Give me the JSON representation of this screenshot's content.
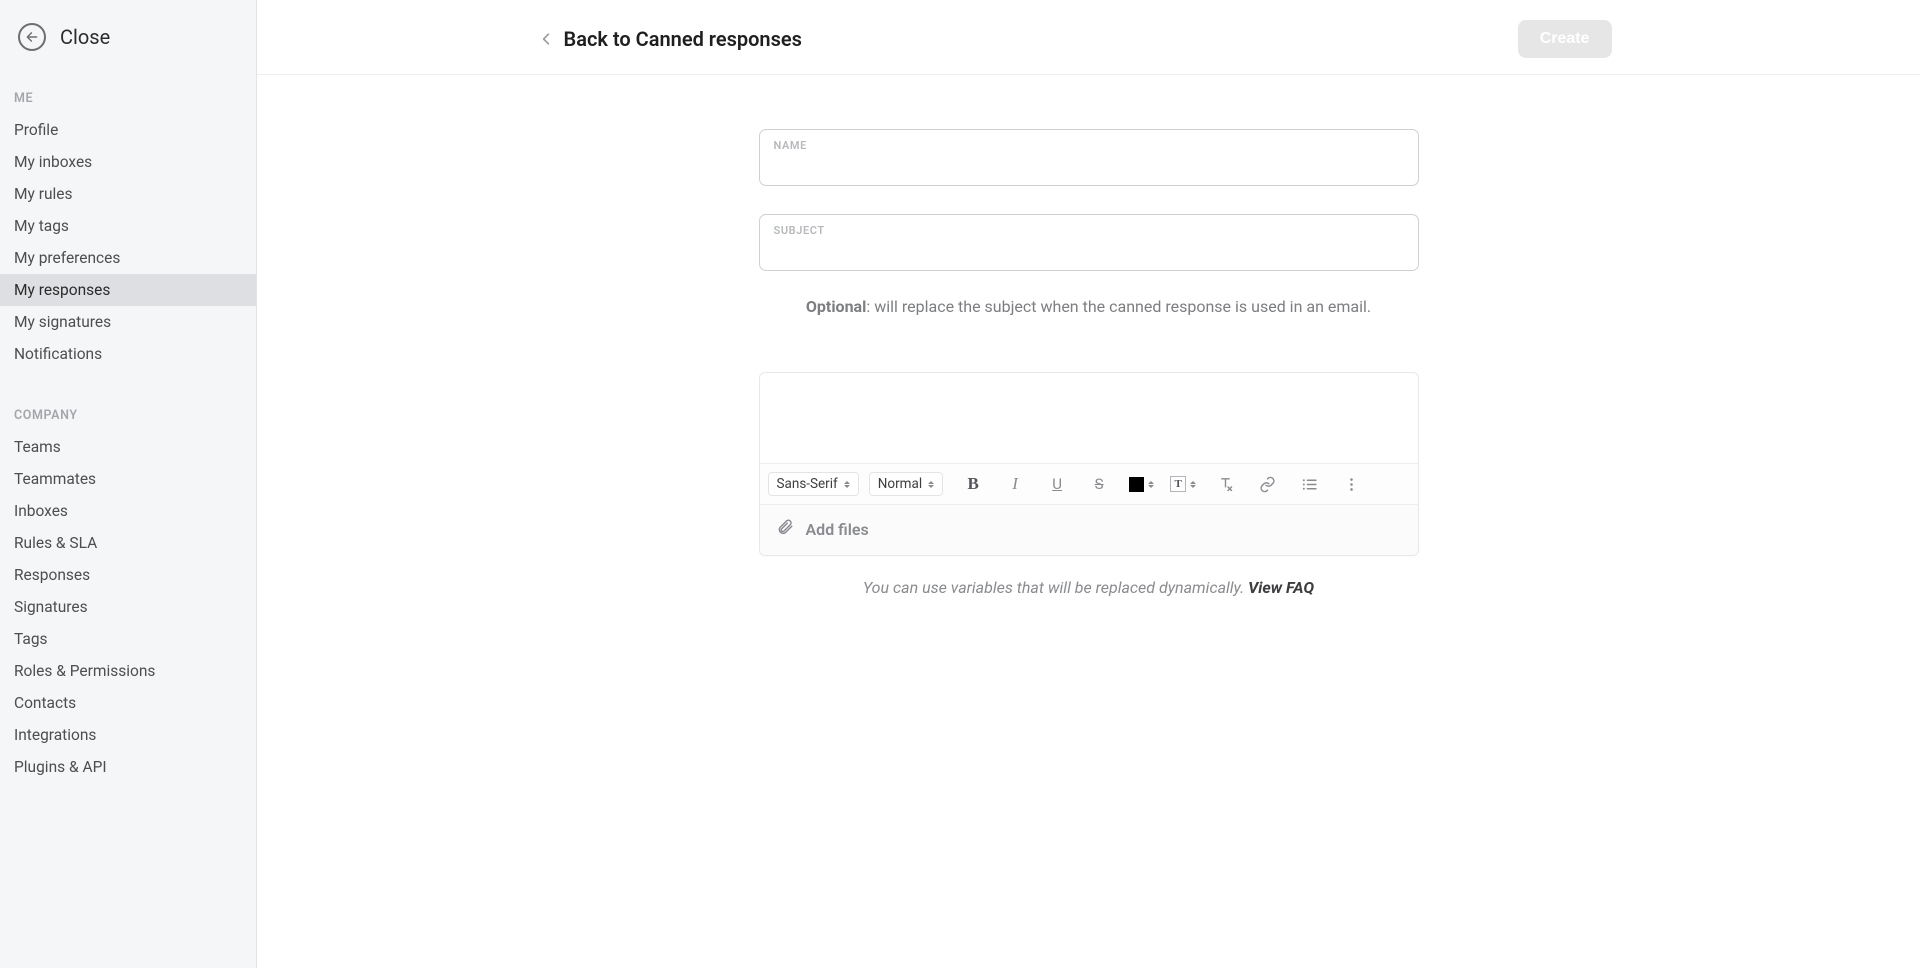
{
  "sidebar": {
    "close_label": "Close",
    "sections": {
      "me": {
        "heading": "ME",
        "items": [
          "Profile",
          "My inboxes",
          "My rules",
          "My tags",
          "My preferences",
          "My responses",
          "My signatures",
          "Notifications"
        ],
        "active_index": 5
      },
      "company": {
        "heading": "COMPANY",
        "items": [
          "Teams",
          "Teammates",
          "Inboxes",
          "Rules & SLA",
          "Responses",
          "Signatures",
          "Tags",
          "Roles & Permissions",
          "Contacts",
          "Integrations",
          "Plugins & API"
        ]
      }
    }
  },
  "header": {
    "back_link": "Back to Canned responses",
    "create_button": "Create"
  },
  "form": {
    "name_label": "NAME",
    "name_value": "",
    "subject_label": "SUBJECT",
    "subject_value": "",
    "subject_helper_bold": "Optional",
    "subject_helper_rest": ": will replace the subject when the canned response is used in an email."
  },
  "editor": {
    "body_value": "",
    "toolbar": {
      "font_family": "Sans-Serif",
      "text_size": "Normal"
    },
    "attach_label": "Add files"
  },
  "footnote": {
    "text": "You can use variables that will be replaced dynamically. ",
    "faq_label": "View FAQ"
  }
}
